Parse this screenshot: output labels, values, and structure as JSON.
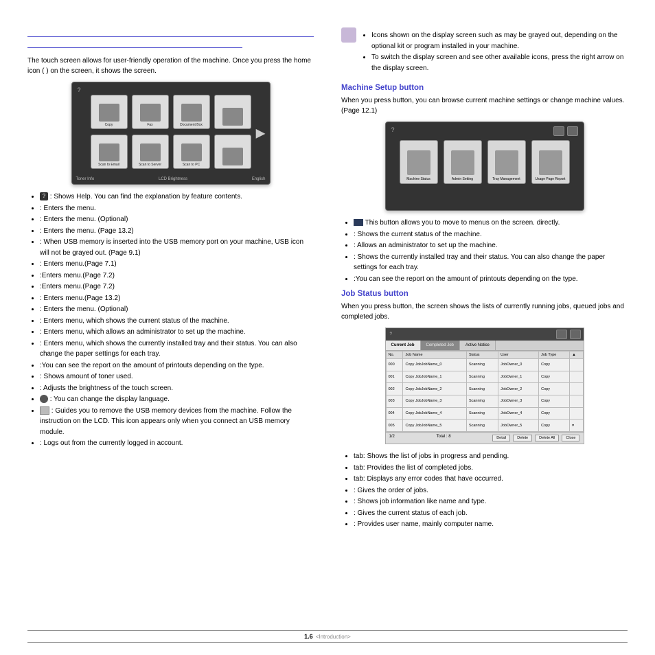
{
  "page": {
    "number": "1.6",
    "section": "<Introduction>"
  },
  "left": {
    "intro": "The touch screen allows for user-friendly operation of the machine. Once you press the home icon (        ) on the screen, it shows the          screen.",
    "mainTiles": {
      "row1": [
        "Copy",
        "Fax",
        "Document Box",
        ""
      ],
      "row2": [
        "Scan to Email",
        "Scan to Server",
        "Scan to PC",
        ""
      ]
    },
    "bottomBar": {
      "left": "Toner Info",
      "mid": "LCD Brightness",
      "right": "English"
    },
    "bullets": [
      {
        "icon": "help",
        "text": ": Shows Help. You can find the explanation by feature contents."
      },
      {
        "text": "        : Enters the          menu."
      },
      {
        "text": "       : Enters the        menu. (Optional)"
      },
      {
        "text": "                        : Enters the                            menu. (Page 13.2)"
      },
      {
        "text": "         : When USB memory is inserted into the USB memory port on your machine, USB icon will not be grayed out. (Page 9.1)"
      },
      {
        "text": "                         : Enters                          menu.(Page 7.1)"
      },
      {
        "text": "                    :Enters                    menu.(Page 7.2)"
      },
      {
        "text": "                        :Enters                        menu.(Page 7.2)"
      },
      {
        "text": "                       : Enters                      menu.(Page 13.2)"
      },
      {
        "text": "                              : Enters the                                   menu. (Optional)"
      },
      {
        "text": "                           : Enters                           menu, which shows the current status of the machine."
      },
      {
        "text": "                           : Enters                           menu, which allows an administrator to set up the machine."
      },
      {
        "text": "                                  : Enters                                  menu, which shows the currently installed tray and their status. You can also change the paper settings for each tray."
      },
      {
        "text": "                                  :You can see the report on the amount of printouts depending on the type."
      },
      {
        "text": "                    : Shows amount of toner used."
      },
      {
        "text": "                             : Adjusts the brightness of the touch screen."
      },
      {
        "icon": "lang",
        "text": ": You can change the display language."
      },
      {
        "icon": "eject",
        "text": ": Guides you to remove the USB memory devices from the machine. Follow the instruction on the LCD. This icon appears only when you connect an USB memory module."
      },
      {
        "text": "              : Logs out from the currently logged in account."
      }
    ]
  },
  "right": {
    "note": {
      "b1": "Icons shown on the display screen such as           may be grayed out, depending on the optional kit or program installed in your machine.",
      "b2": "To switch the display screen and see other available icons, press the right arrow on the display screen."
    },
    "setup": {
      "title": "Machine Setup button",
      "intro": "When you press                           button, you can browse current machine settings or change machine values. (Page 12.1)",
      "tiles": [
        "Machine Status",
        "Admin Setting",
        "Tray Management",
        "Usage Page Report"
      ],
      "bullets": [
        {
          "icon": "back",
          "text": "This button allows you to move to menus on the             screen. directly."
        },
        {
          "text": "                            : Shows the current status of the machine."
        },
        {
          "text": "                            : Allows an administrator to set up the machine."
        },
        {
          "text": "                                  : Shows the currently installed tray and their status. You can also change the paper settings for each tray."
        },
        {
          "text": "                                  :You can see the report on the amount of printouts depending on the type."
        }
      ]
    },
    "job": {
      "title": "Job Status button",
      "intro": "When you press                     button, the screen shows the lists of currently running jobs, queued jobs and completed jobs.",
      "tabs": [
        "Current Job",
        "Completed Job",
        "Active Notice"
      ],
      "headers": [
        "No.",
        "Job Name",
        "Status",
        "User",
        "Job Type"
      ],
      "rows": [
        [
          "000",
          "Copy JobJobName_0",
          "Scanning",
          "JobOwner_0",
          "Copy"
        ],
        [
          "001",
          "Copy JobJobName_1",
          "Scanning",
          "JobOwner_1",
          "Copy"
        ],
        [
          "002",
          "Copy JobJobName_2",
          "Scanning",
          "JobOwner_2",
          "Copy"
        ],
        [
          "003",
          "Copy JobJobName_3",
          "Scanning",
          "JobOwner_3",
          "Copy"
        ],
        [
          "004",
          "Copy JobJobName_4",
          "Scanning",
          "JobOwner_4",
          "Copy"
        ],
        [
          "005",
          "Copy JobJobName_5",
          "Scanning",
          "JobOwner_5",
          "Copy"
        ]
      ],
      "footer": {
        "left": "1/2",
        "total": "Total : 8",
        "btns": [
          "Detail",
          "Delete",
          "Delete All",
          "Close"
        ]
      },
      "bullets": [
        "                     tab: Shows the list of jobs in progress and pending.",
        "                             tab: Provides the list of completed jobs.",
        "                          tab: Displays any error codes that have occurred.",
        "       : Gives the order of jobs.",
        "                   : Shows job information like name and type.",
        "            : Gives the current status of each job.",
        "         : Provides user name, mainly computer name."
      ]
    }
  }
}
